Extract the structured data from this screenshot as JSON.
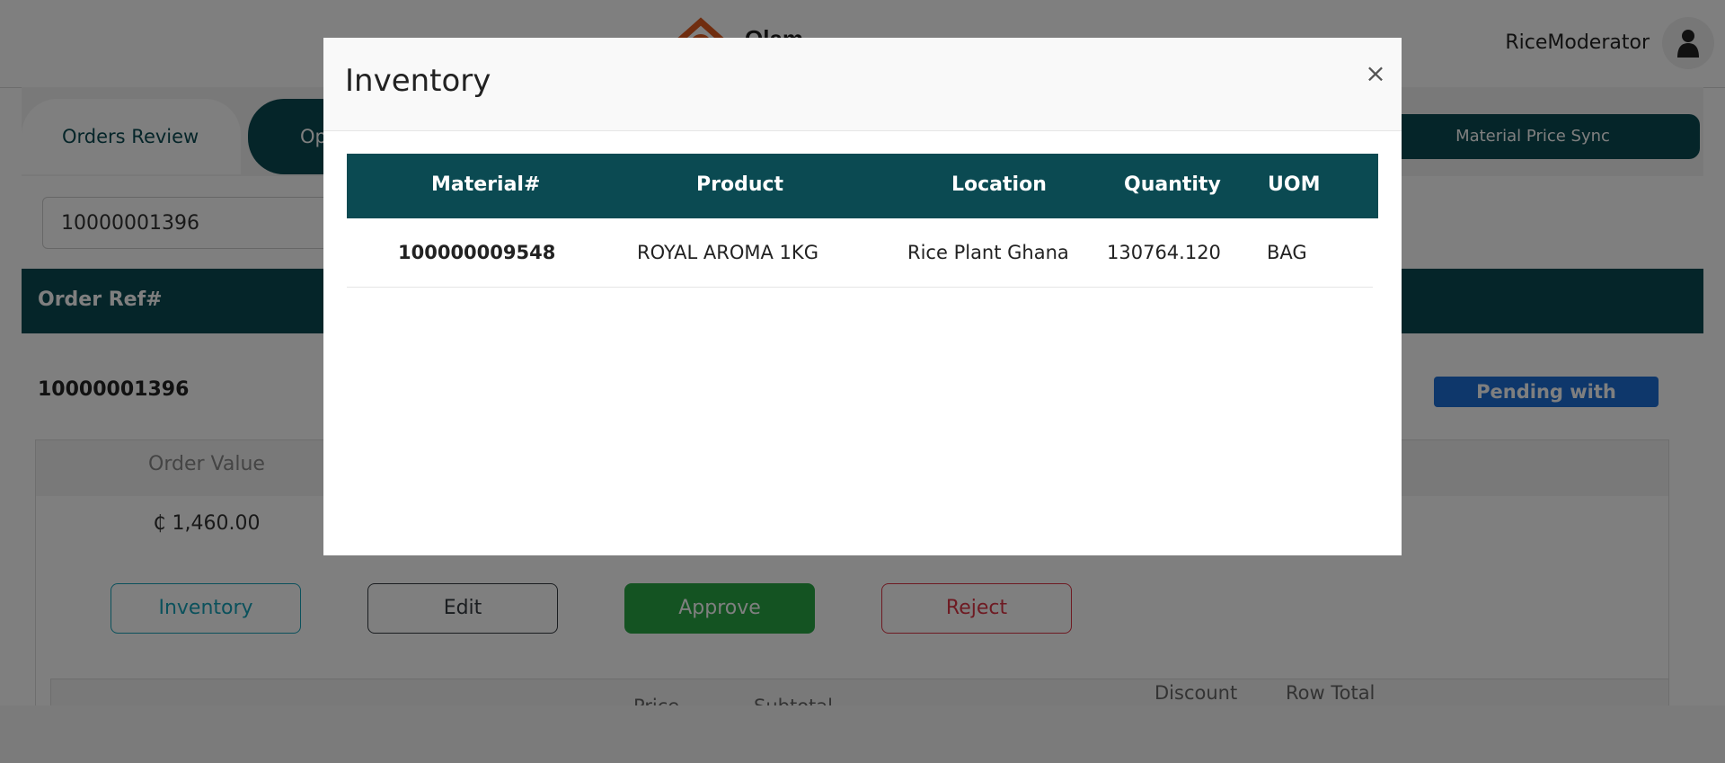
{
  "header": {
    "logo_text": "Olam",
    "username": "RiceModerator"
  },
  "tabs": {
    "orders_review": "Orders Review",
    "second_partial": "Op",
    "material_price_sync": "Material Price Sync"
  },
  "search": {
    "value": "10000001396"
  },
  "orders_table": {
    "header": "Order Ref#",
    "order_ref": "10000001396",
    "status": "Pending with SO/ASM",
    "order_value_label": "Order Value",
    "order_value": "₵ 1,460.00"
  },
  "actions": {
    "inventory": "Inventory",
    "edit": "Edit",
    "approve": "Approve",
    "reject": "Reject"
  },
  "items_table_headers": {
    "price": "Price",
    "subtotal": "Subtotal",
    "discount": "Discount",
    "row_total": "Row Total"
  },
  "modal": {
    "title": "Inventory",
    "close": "×",
    "columns": [
      "Material#",
      "Product",
      "Location",
      "Quantity",
      "UOM"
    ],
    "rows": [
      {
        "material": "100000009548",
        "product": "ROYAL AROMA 1KG",
        "location": "Rice Plant Ghana",
        "quantity": "130764.120",
        "uom": "BAG"
      }
    ]
  },
  "colors": {
    "brand_teal": "#0b4a52",
    "status_blue": "#1d6fd6",
    "approve_green": "#28a745",
    "reject_red": "#dc3545",
    "inventory_cyan": "#17a2b8",
    "logo_orange": "#e05a1e"
  }
}
